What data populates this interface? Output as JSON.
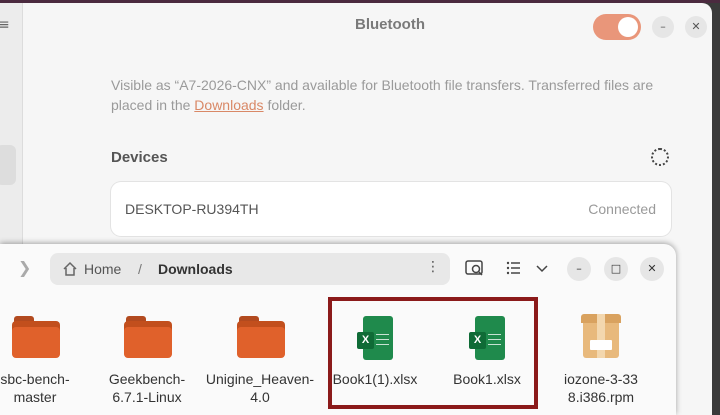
{
  "settings": {
    "title": "Bluetooth",
    "bluetooth_enabled": true,
    "description_part1": "Visible as “A7-2026-CNX” and available for Bluetooth file transfers. Transferred files are placed in the ",
    "downloads_link": "Downloads",
    "description_part2": " folder.",
    "devices_heading": "Devices",
    "devices": [
      {
        "name": "DESKTOP-RU394TH",
        "status": "Connected"
      }
    ],
    "window_buttons": {
      "minimize": "–",
      "close": "✕"
    }
  },
  "files": {
    "path": {
      "home": "Home",
      "separator": "/",
      "current": "Downloads"
    },
    "toolbar": {
      "more_label": "⋮",
      "search_icon": "search-folder-icon",
      "view_icon": "list-view-icon",
      "dropdown_icon": "chevron-down-icon"
    },
    "window_buttons": {
      "minimize": "–",
      "maximize": "□",
      "close": "✕"
    },
    "items": [
      {
        "label": "sbc-bench-master",
        "type": "folder"
      },
      {
        "label": "Geekbench-6.7.1-Linux",
        "type": "folder"
      },
      {
        "label": "Unigine_Heaven-4.0",
        "type": "folder"
      },
      {
        "label": "Book1(1).xlsx",
        "type": "spreadsheet"
      },
      {
        "label": "Book1.xlsx",
        "type": "spreadsheet"
      },
      {
        "label": "iozone-3-338.i386.rpm",
        "type": "package"
      }
    ]
  },
  "colors": {
    "accent": "#e9967a",
    "link": "#d98866",
    "folder": "#e0612b",
    "spreadsheet": "#1f8a4c",
    "highlight": "#8b1a1a"
  }
}
